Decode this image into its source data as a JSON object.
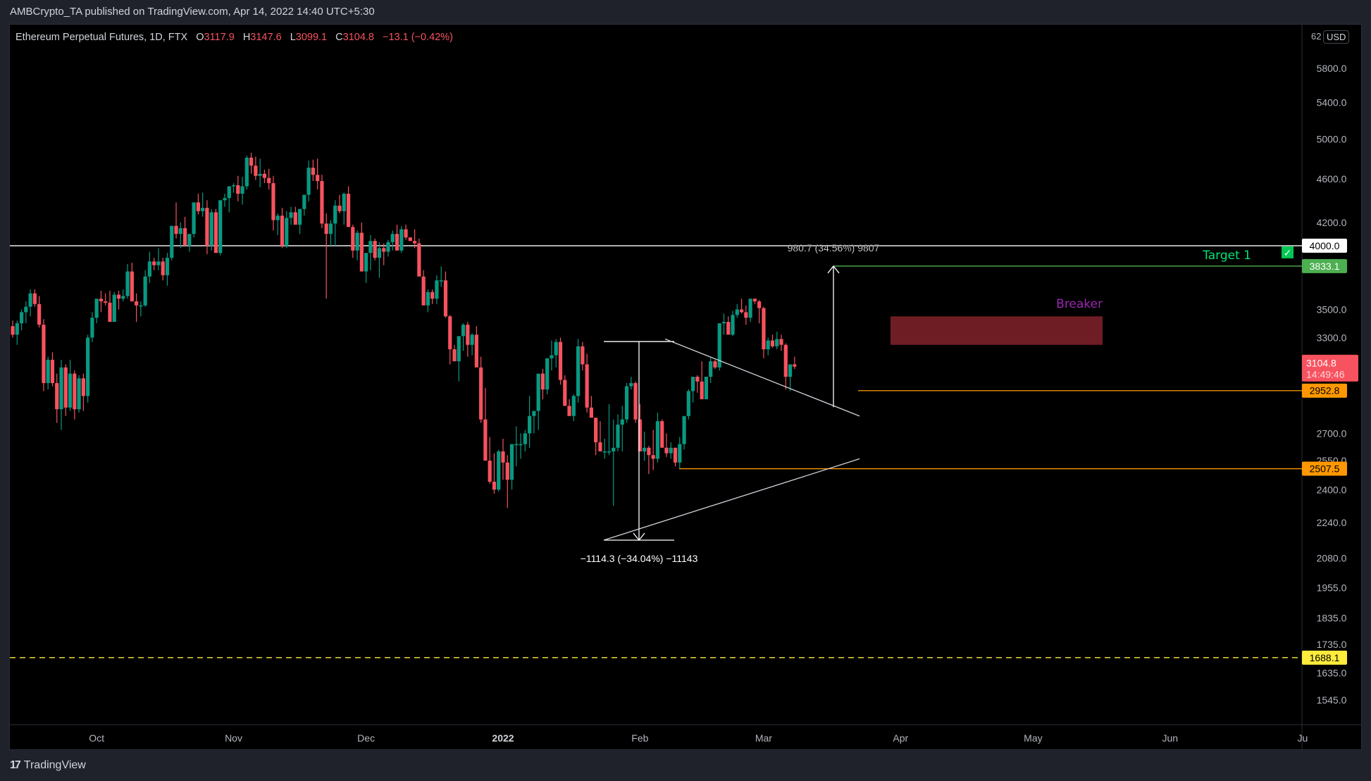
{
  "header": {
    "published": "AMBCrypto_TA published on TradingView.com, Apr 14, 2022 14:40 UTC+5:30"
  },
  "legend": {
    "symbol": "Ethereum Perpetual Futures, 1D, FTX",
    "open_label": "O",
    "open": "3117.9",
    "high_label": "H",
    "high": "3147.6",
    "low_label": "L",
    "low": "3099.1",
    "close_label": "C",
    "close": "3104.8",
    "change": "−13.1 (−0.42%)"
  },
  "currency": "USD",
  "currency_prefix": "62",
  "footer": {
    "brand": "TradingView",
    "logo": "17"
  },
  "colors": {
    "up": "#089981",
    "down": "#f7525f",
    "axis_text": "#b2b5be",
    "white_line": "#ffffff",
    "target_green": "#4caf50",
    "target_text": "#00e676",
    "orange": "#ff9800",
    "yellow": "#ffeb3b",
    "breaker_fill": "#6f1d24",
    "breaker_text": "#9c27b0",
    "price_badge": "#f7525f"
  },
  "chart_data": {
    "type": "candlestick",
    "title": "Ethereum Perpetual Futures, 1D, FTX",
    "scale": "log",
    "ylim": [
      1450,
      6300
    ],
    "y_ticks": [
      5800.0,
      5400.0,
      5000.0,
      4600.0,
      4200.0,
      3500.0,
      3300.0,
      2700.0,
      2550.0,
      2400.0,
      2240.0,
      2080.0,
      1955.0,
      1835.0,
      1735.0,
      1635.0,
      1545.0
    ],
    "x_ticks": [
      {
        "label": "Oct",
        "date": "2021-10-01"
      },
      {
        "label": "Nov",
        "date": "2021-11-01"
      },
      {
        "label": "Dec",
        "date": "2021-12-01"
      },
      {
        "label": "2022",
        "date": "2022-01-01",
        "bold": true
      },
      {
        "label": "Feb",
        "date": "2022-02-01"
      },
      {
        "label": "Mar",
        "date": "2022-03-01"
      },
      {
        "label": "Apr",
        "date": "2022-04-01"
      },
      {
        "label": "May",
        "date": "2022-05-01"
      },
      {
        "label": "Jun",
        "date": "2022-06-01"
      },
      {
        "label": "Ju",
        "date": "2022-07-01"
      }
    ],
    "start_date": "2021-09-12",
    "candles": [
      [
        3380,
        3420,
        3300,
        3320
      ],
      [
        3320,
        3420,
        3250,
        3400
      ],
      [
        3400,
        3500,
        3350,
        3480
      ],
      [
        3480,
        3560,
        3400,
        3520
      ],
      [
        3520,
        3650,
        3450,
        3620
      ],
      [
        3620,
        3650,
        3520,
        3540
      ],
      [
        3540,
        3600,
        3370,
        3390
      ],
      [
        3390,
        3430,
        2950,
        3000
      ],
      [
        3000,
        3170,
        2960,
        3150
      ],
      [
        3150,
        3200,
        2980,
        3000
      ],
      [
        3000,
        3060,
        2760,
        2840
      ],
      [
        2840,
        3150,
        2720,
        3100
      ],
      [
        3100,
        3120,
        2800,
        2850
      ],
      [
        2850,
        3150,
        2830,
        3060
      ],
      [
        3060,
        3080,
        2780,
        2840
      ],
      [
        2840,
        3050,
        2820,
        3030
      ],
      [
        3030,
        3060,
        2830,
        2920
      ],
      [
        2920,
        3320,
        2880,
        3300
      ],
      [
        3300,
        3480,
        3270,
        3440
      ],
      [
        3440,
        3570,
        3400,
        3580
      ],
      [
        3580,
        3640,
        3480,
        3560
      ],
      [
        3560,
        3620,
        3530,
        3550
      ],
      [
        3550,
        3640,
        3420,
        3410
      ],
      [
        3410,
        3630,
        3420,
        3610
      ],
      [
        3610,
        3640,
        3500,
        3580
      ],
      [
        3580,
        3650,
        3560,
        3600
      ],
      [
        3600,
        3850,
        3580,
        3790
      ],
      [
        3790,
        3860,
        3620,
        3560
      ],
      [
        3560,
        3620,
        3410,
        3530
      ],
      [
        3530,
        3560,
        3450,
        3530
      ],
      [
        3530,
        3800,
        3520,
        3750
      ],
      [
        3750,
        3950,
        3700,
        3870
      ],
      [
        3870,
        3900,
        3800,
        3840
      ],
      [
        3840,
        3980,
        3800,
        3870
      ],
      [
        3870,
        3900,
        3720,
        3760
      ],
      [
        3760,
        3940,
        3680,
        3900
      ],
      [
        3900,
        4170,
        3880,
        4170
      ],
      [
        4170,
        4380,
        4060,
        4100
      ],
      [
        4100,
        4200,
        3980,
        4150
      ],
      [
        4150,
        4250,
        4020,
        4000
      ],
      [
        4000,
        4090,
        3950,
        4100
      ],
      [
        4100,
        4300,
        4070,
        4380
      ],
      [
        4380,
        4460,
        4270,
        4300
      ],
      [
        4300,
        4470,
        4250,
        4330
      ],
      [
        4330,
        4400,
        3930,
        4000
      ],
      [
        4000,
        4320,
        3960,
        4290
      ],
      [
        4290,
        4320,
        4000,
        3940
      ],
      [
        3940,
        4400,
        3920,
        4400
      ],
      [
        4400,
        4460,
        4340,
        4420
      ],
      [
        4420,
        4530,
        4290,
        4530
      ],
      [
        4530,
        4560,
        4470,
        4540
      ],
      [
        4540,
        4630,
        4390,
        4460
      ],
      [
        4460,
        4620,
        4360,
        4530
      ],
      [
        4530,
        4830,
        4500,
        4810
      ],
      [
        4810,
        4860,
        4650,
        4730
      ],
      [
        4730,
        4820,
        4590,
        4630
      ],
      [
        4630,
        4800,
        4520,
        4650
      ],
      [
        4650,
        4690,
        4560,
        4610
      ],
      [
        4610,
        4700,
        4500,
        4560
      ],
      [
        4560,
        4630,
        4130,
        4220
      ],
      [
        4220,
        4280,
        4090,
        4260
      ],
      [
        4260,
        4330,
        3980,
        4000
      ],
      [
        4000,
        4300,
        3980,
        4240
      ],
      [
        4240,
        4340,
        4180,
        4290
      ],
      [
        4290,
        4340,
        4210,
        4180
      ],
      [
        4180,
        4300,
        4100,
        4320
      ],
      [
        4320,
        4420,
        4260,
        4450
      ],
      [
        4450,
        4780,
        4390,
        4710
      ],
      [
        4710,
        4790,
        4580,
        4640
      ],
      [
        4640,
        4800,
        4500,
        4580
      ],
      [
        4580,
        4640,
        4150,
        4190
      ],
      [
        4190,
        4280,
        3580,
        4100
      ],
      [
        4100,
        4220,
        4000,
        4190
      ],
      [
        4190,
        4400,
        4000,
        4350
      ],
      [
        4350,
        4450,
        4280,
        4300
      ],
      [
        4300,
        4470,
        4180,
        4460
      ],
      [
        4460,
        4530,
        4200,
        4160
      ],
      [
        4160,
        4180,
        3900,
        3960
      ],
      [
        3960,
        4130,
        3880,
        4110
      ],
      [
        4110,
        4200,
        3830,
        3790
      ],
      [
        3790,
        3900,
        3700,
        3940
      ],
      [
        3940,
        4090,
        3800,
        4040
      ],
      [
        4040,
        4060,
        3880,
        3900
      ],
      [
        3900,
        4030,
        3740,
        3980
      ],
      [
        3980,
        4020,
        3840,
        3950
      ],
      [
        3950,
        4050,
        3910,
        4030
      ],
      [
        4030,
        4130,
        3960,
        4100
      ],
      [
        4100,
        4180,
        3960,
        3960
      ],
      [
        3960,
        4170,
        3940,
        4140
      ],
      [
        4140,
        4180,
        4050,
        4070
      ],
      [
        4070,
        4070,
        4040,
        4040
      ],
      [
        4040,
        4140,
        3980,
        4020
      ],
      [
        4020,
        4060,
        3890,
        3750
      ],
      [
        3750,
        3800,
        3690,
        3530
      ],
      [
        3530,
        3650,
        3480,
        3630
      ],
      [
        3630,
        3650,
        3540,
        3580
      ],
      [
        3580,
        3760,
        3540,
        3720
      ],
      [
        3720,
        3830,
        3670,
        3720
      ],
      [
        3720,
        3790,
        3440,
        3450
      ],
      [
        3450,
        3460,
        3120,
        3220
      ],
      [
        3220,
        3250,
        3170,
        3140
      ],
      [
        3140,
        3270,
        3010,
        3310
      ],
      [
        3310,
        3400,
        3210,
        3390
      ],
      [
        3390,
        3410,
        3170,
        3250
      ],
      [
        3250,
        3330,
        3180,
        3320
      ],
      [
        3320,
        3380,
        3230,
        3100
      ],
      [
        3100,
        3170,
        2760,
        2780
      ],
      [
        2780,
        2970,
        2570,
        2550
      ],
      [
        2550,
        2680,
        2430,
        2440
      ],
      [
        2440,
        2590,
        2380,
        2400
      ],
      [
        2400,
        2610,
        2390,
        2600
      ],
      [
        2600,
        2670,
        2450,
        2540
      ],
      [
        2540,
        2580,
        2310,
        2450
      ],
      [
        2450,
        2570,
        2400,
        2640
      ],
      [
        2640,
        2740,
        2520,
        2640
      ],
      [
        2640,
        2700,
        2560,
        2640
      ],
      [
        2640,
        2720,
        2600,
        2700
      ],
      [
        2700,
        2920,
        2620,
        2800
      ],
      [
        2800,
        2830,
        2700,
        2830
      ],
      [
        2830,
        3050,
        2720,
        3060
      ],
      [
        3060,
        3090,
        2900,
        2960
      ],
      [
        2960,
        3160,
        2930,
        3160
      ],
      [
        3160,
        3280,
        3080,
        3180
      ],
      [
        3180,
        3290,
        3100,
        3270
      ],
      [
        3270,
        3300,
        2990,
        3020
      ],
      [
        3020,
        3050,
        2890,
        2860
      ],
      [
        2860,
        2900,
        2800,
        2800
      ],
      [
        2800,
        2930,
        2770,
        2920
      ],
      [
        2920,
        3290,
        2880,
        3240
      ],
      [
        3240,
        3270,
        3080,
        3120
      ],
      [
        3120,
        3190,
        2820,
        2850
      ],
      [
        2850,
        2920,
        2800,
        2790
      ],
      [
        2790,
        2780,
        2580,
        2650
      ],
      [
        2650,
        2770,
        2600,
        2600
      ],
      [
        2600,
        2670,
        2560,
        2600
      ],
      [
        2600,
        2870,
        2580,
        2600
      ],
      [
        2600,
        2780,
        2320,
        2620
      ],
      [
        2620,
        2810,
        2600,
        2750
      ],
      [
        2750,
        2860,
        2600,
        2780
      ],
      [
        2780,
        3000,
        2760,
        2980
      ],
      [
        2980,
        3040,
        2960,
        3000
      ],
      [
        3000,
        3010,
        2760,
        2780
      ],
      [
        2780,
        2870,
        2720,
        2600
      ],
      [
        2600,
        2710,
        2550,
        2620
      ],
      [
        2620,
        2630,
        2480,
        2580
      ],
      [
        2580,
        2720,
        2500,
        2560
      ],
      [
        2560,
        2820,
        2540,
        2770
      ],
      [
        2770,
        2780,
        2640,
        2620
      ],
      [
        2620,
        2700,
        2570,
        2590
      ],
      [
        2590,
        2650,
        2560,
        2620
      ],
      [
        2620,
        2620,
        2520,
        2540
      ],
      [
        2540,
        2680,
        2510,
        2640
      ],
      [
        2640,
        2720,
        2610,
        2800
      ],
      [
        2800,
        2960,
        2780,
        2950
      ],
      [
        2950,
        3000,
        2880,
        3040
      ],
      [
        3040,
        3050,
        2940,
        3010
      ],
      [
        3010,
        3140,
        2920,
        2900
      ],
      [
        2900,
        3040,
        2940,
        3040
      ],
      [
        3040,
        3170,
        3000,
        3140
      ],
      [
        3140,
        3150,
        3090,
        3100
      ],
      [
        3100,
        3400,
        3080,
        3400
      ],
      [
        3400,
        3470,
        3320,
        3410
      ],
      [
        3410,
        3450,
        3330,
        3320
      ],
      [
        3320,
        3490,
        3310,
        3460
      ],
      [
        3460,
        3540,
        3440,
        3500
      ],
      [
        3500,
        3580,
        3470,
        3480
      ],
      [
        3480,
        3530,
        3390,
        3440
      ],
      [
        3440,
        3580,
        3410,
        3580
      ],
      [
        3580,
        3580,
        3540,
        3560
      ],
      [
        3560,
        3570,
        3400,
        3510
      ],
      [
        3510,
        3520,
        3160,
        3220
      ],
      [
        3220,
        3300,
        3180,
        3280
      ],
      [
        3280,
        3320,
        3230,
        3240
      ],
      [
        3240,
        3340,
        3220,
        3290
      ],
      [
        3290,
        3320,
        3210,
        3250
      ],
      [
        3250,
        3260,
        2960,
        3040
      ],
      [
        3040,
        3120,
        2950,
        3120
      ],
      [
        3120,
        3170,
        3090,
        3105
      ]
    ],
    "horizontal_levels": [
      {
        "name": "resistance-4000",
        "value": 4000.0,
        "label": "4000.0",
        "color": "#ffffff"
      },
      {
        "name": "target-1",
        "value": 3833.1,
        "label": "3833.1",
        "color": "#4caf50",
        "text": "Target 1",
        "check": "✓"
      },
      {
        "name": "support-2952",
        "value": 2952.8,
        "label": "2952.8",
        "color": "#ff9800"
      },
      {
        "name": "support-2507",
        "value": 2507.5,
        "label": "2507.5",
        "color": "#ff9800"
      },
      {
        "name": "dashed-1688",
        "value": 1688.1,
        "label": "1688.1",
        "color": "#ffeb3b",
        "dashed": true
      }
    ],
    "current_price": {
      "value": "3104.8",
      "countdown": "14:49:46"
    },
    "annotations": [
      {
        "type": "measure-down",
        "text": "−1114.3 (−34.04%) −11143",
        "from": 3273,
        "to": 2159
      },
      {
        "type": "measure-up",
        "text": "980.7 (34.56%) 9807",
        "from": 2852,
        "to": 3833
      },
      {
        "type": "zone",
        "text": "Breaker",
        "top": 3450,
        "bottom": 3250
      },
      {
        "type": "trendline-upper",
        "text": "descending triangle upper"
      },
      {
        "type": "trendline-lower",
        "text": "ascending triangle lower"
      }
    ]
  }
}
